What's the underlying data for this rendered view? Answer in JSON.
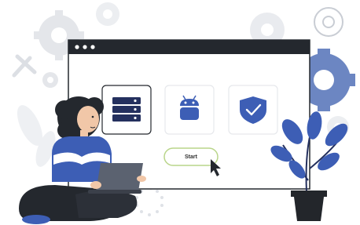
{
  "start_button": {
    "label": "Start"
  },
  "icons": {
    "tile1": "server-stack-icon",
    "tile2": "android-robot-icon",
    "tile3": "shield-check-icon"
  },
  "colors": {
    "accent_blue": "#3d5eb5",
    "dark": "#24282e",
    "button_border": "#b9d58a",
    "gear_gray": "#e6e8ec",
    "plant_pot": "#23262b"
  }
}
